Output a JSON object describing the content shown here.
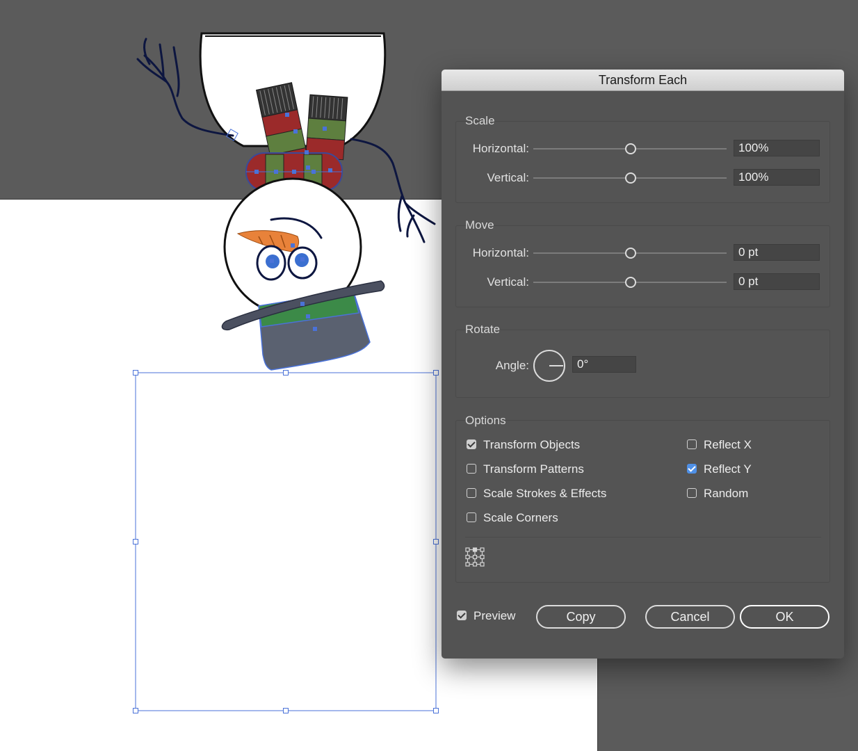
{
  "dialog": {
    "title": "Transform Each",
    "scale": {
      "section_label": "Scale",
      "horizontal_label": "Horizontal:",
      "horizontal_value": "100%",
      "vertical_label": "Vertical:",
      "vertical_value": "100%"
    },
    "move": {
      "section_label": "Move",
      "horizontal_label": "Horizontal:",
      "horizontal_value": "0 pt",
      "vertical_label": "Vertical:",
      "vertical_value": "0 pt"
    },
    "rotate": {
      "section_label": "Rotate",
      "angle_label": "Angle:",
      "angle_value": "0°"
    },
    "options": {
      "section_label": "Options",
      "transform_objects": {
        "label": "Transform Objects",
        "checked": true
      },
      "transform_patterns": {
        "label": "Transform Patterns",
        "checked": false
      },
      "scale_strokes_effects": {
        "label": "Scale Strokes & Effects",
        "checked": false
      },
      "scale_corners": {
        "label": "Scale Corners",
        "checked": false
      },
      "reflect_x": {
        "label": "Reflect X",
        "checked": false
      },
      "reflect_y": {
        "label": "Reflect Y",
        "checked": true
      },
      "random": {
        "label": "Random",
        "checked": false
      },
      "reference_point_icon": "reference-point-grid"
    },
    "preview": {
      "label": "Preview",
      "checked": true
    },
    "buttons": {
      "copy": "Copy",
      "cancel": "Cancel",
      "ok": "OK"
    }
  },
  "colors": {
    "canvas_background": "#5b5b5b",
    "artboard": "#ffffff",
    "dialog_background": "#535353",
    "selection": "#4a72d8",
    "checkbox_accent": "#4f90e6",
    "scarf_red": "#9b2a2a",
    "scarf_green": "#5e7f3f",
    "hat_band_green": "#3c8a48",
    "hat_gray": "#5a6170",
    "carrot_orange": "#e8823a",
    "eye_blue": "#3b6fd0"
  }
}
